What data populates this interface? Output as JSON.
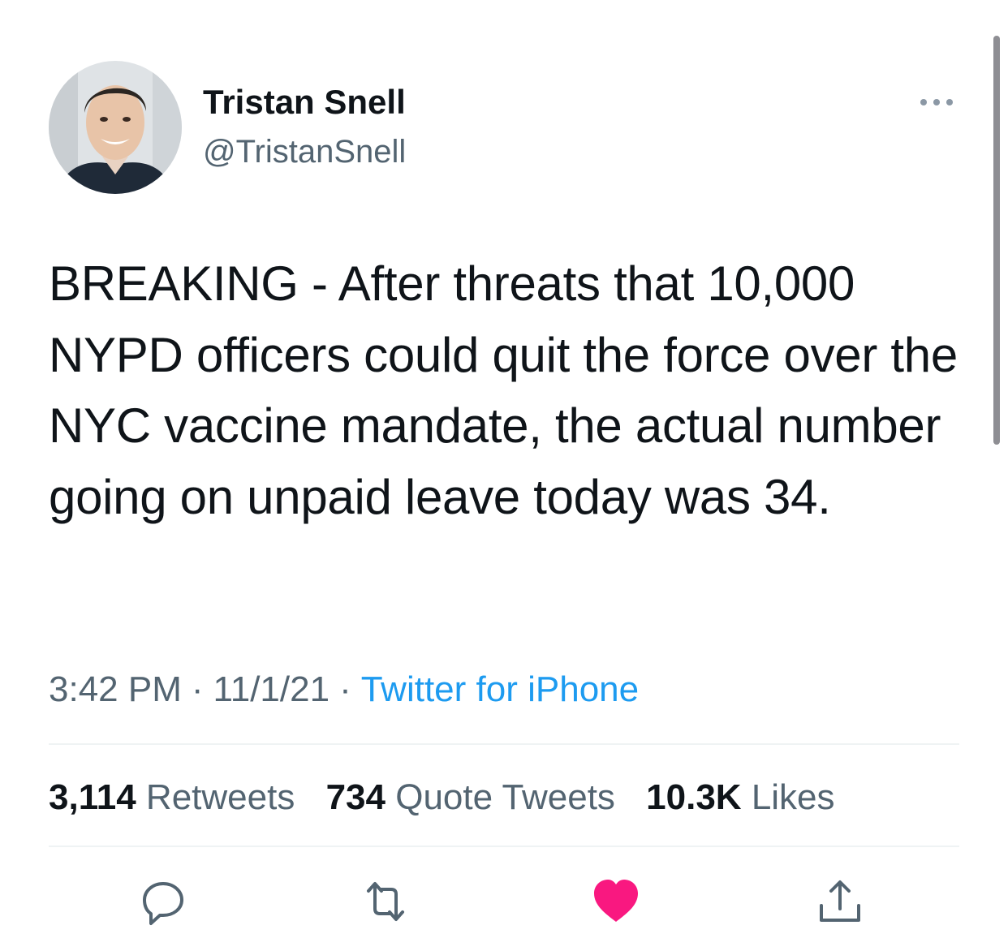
{
  "author": {
    "display_name": "Tristan Snell",
    "handle": "@TristanSnell"
  },
  "tweet": {
    "text": "BREAKING - After threats that 10,000 NYPD officers could quit the force over the NYC vaccine mandate, the actual number going on unpaid leave today was 34.",
    "time": "3:42 PM",
    "date": "11/1/21",
    "separator": "·",
    "source": "Twitter for iPhone"
  },
  "stats": {
    "retweets": {
      "count": "3,114",
      "label": "Retweets"
    },
    "quote_tweets": {
      "count": "734",
      "label": "Quote Tweets"
    },
    "likes": {
      "count": "10.3K",
      "label": "Likes"
    }
  },
  "actions": {
    "reply": {
      "icon": "reply-icon"
    },
    "retweet": {
      "icon": "retweet-icon"
    },
    "like": {
      "icon": "heart-icon",
      "liked": true
    },
    "share": {
      "icon": "share-icon"
    }
  },
  "colors": {
    "text": "#0f1419",
    "secondary_text": "#536471",
    "link": "#1d9bf0",
    "like": "#f91880",
    "divider": "#eff3f4"
  }
}
